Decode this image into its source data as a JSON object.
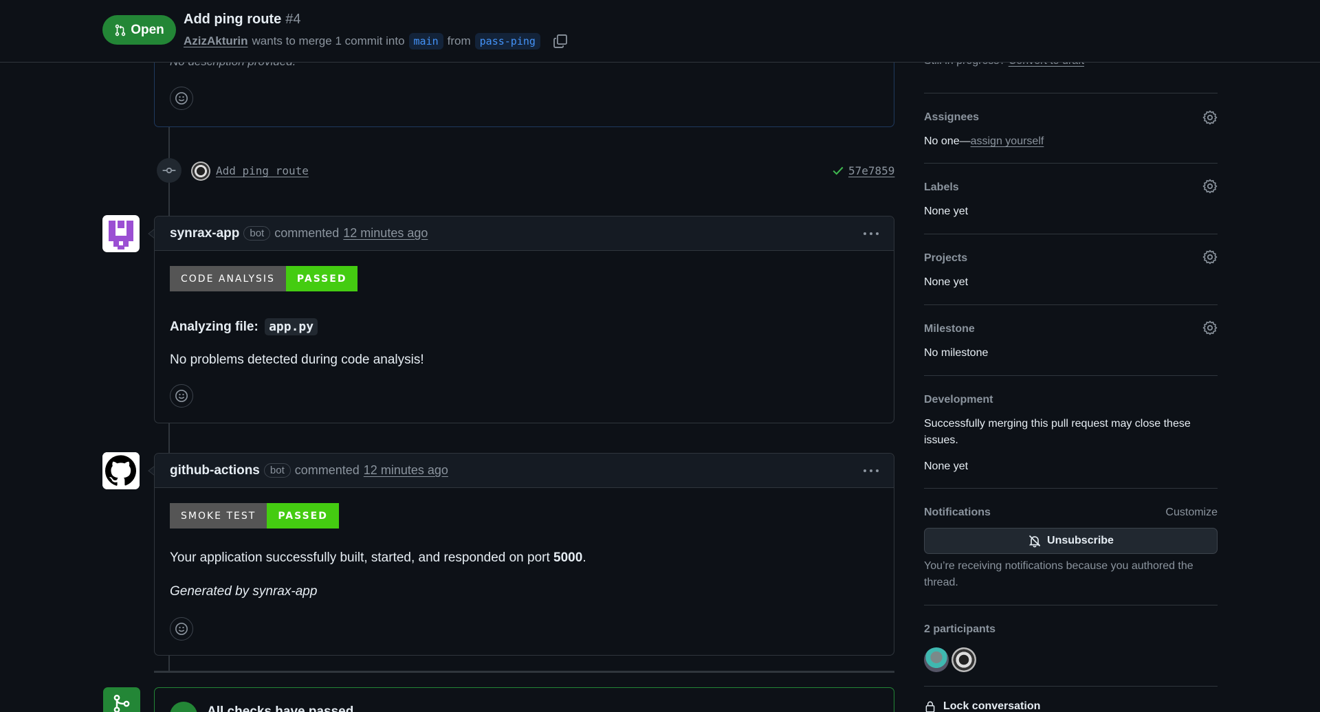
{
  "header": {
    "state": "Open",
    "title": "Add ping route",
    "number": "#4",
    "author": "AzizAkturin",
    "merge_text": "wants to merge 1 commit into",
    "base_branch": "main",
    "from_text": "from",
    "head_branch": "pass-ping"
  },
  "description": {
    "text": "No description provided."
  },
  "commit": {
    "message": "Add ping route",
    "sha": "57e7859"
  },
  "comments": [
    {
      "author": "synrax-app",
      "badge": "bot",
      "action": "commented",
      "time": "12 minutes ago",
      "shield_label": "CODE ANALYSIS",
      "shield_status": "PASSED",
      "heading_prefix": "Analyzing file:",
      "heading_file": "app.py",
      "body": "No problems detected during code analysis!"
    },
    {
      "author": "github-actions",
      "badge": "bot",
      "action": "commented",
      "time": "12 minutes ago",
      "shield_label": "SMOKE TEST",
      "shield_status": "PASSED",
      "body_prefix": "Your application successfully built, started, and responded on port",
      "body_port": "5000",
      "body_suffix": ".",
      "footer": "Generated by synrax-app"
    }
  ],
  "checks": {
    "title": "All checks have passed"
  },
  "sidebar": {
    "draft_prefix": "Still in progress?",
    "draft_link": "Convert to draft",
    "assignees": {
      "title": "Assignees",
      "value_prefix": "No one—",
      "value_link": "assign yourself"
    },
    "labels": {
      "title": "Labels",
      "value": "None yet"
    },
    "projects": {
      "title": "Projects",
      "value": "None yet"
    },
    "milestone": {
      "title": "Milestone",
      "value": "No milestone"
    },
    "development": {
      "title": "Development",
      "desc": "Successfully merging this pull request may close these issues.",
      "value": "None yet"
    },
    "notifications": {
      "title": "Notifications",
      "customize": "Customize",
      "button": "Unsubscribe",
      "reason": "You’re receiving notifications because you authored the thread."
    },
    "participants": {
      "title": "2 participants"
    },
    "lock": {
      "label": "Lock conversation"
    }
  },
  "colors": {
    "open_green": "#238636",
    "shield_green": "#44cc11",
    "link_blue": "#4493f8"
  }
}
